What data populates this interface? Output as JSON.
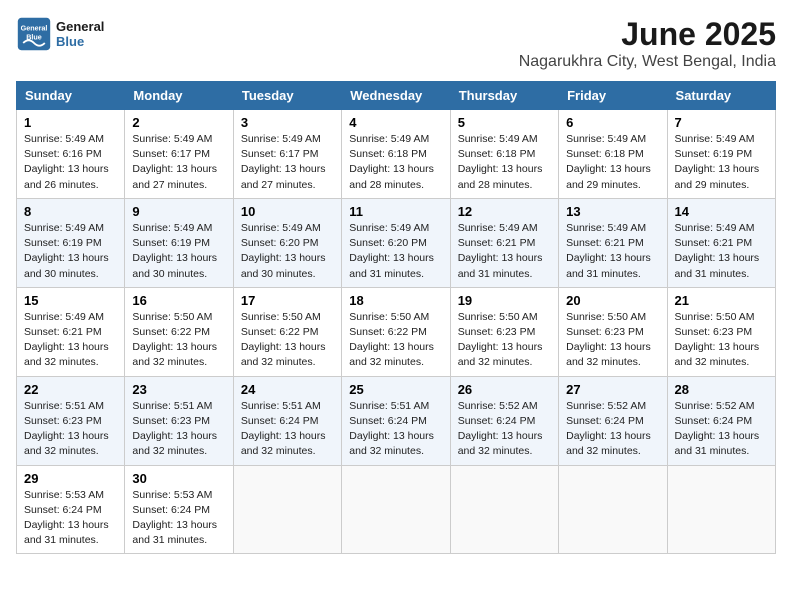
{
  "logo": {
    "line1": "General",
    "line2": "Blue"
  },
  "title": "June 2025",
  "subtitle": "Nagarukhra City, West Bengal, India",
  "days_of_week": [
    "Sunday",
    "Monday",
    "Tuesday",
    "Wednesday",
    "Thursday",
    "Friday",
    "Saturday"
  ],
  "weeks": [
    [
      {
        "day": "1",
        "sunrise": "5:49 AM",
        "sunset": "6:16 PM",
        "daylight": "13 hours and 26 minutes."
      },
      {
        "day": "2",
        "sunrise": "5:49 AM",
        "sunset": "6:17 PM",
        "daylight": "13 hours and 27 minutes."
      },
      {
        "day": "3",
        "sunrise": "5:49 AM",
        "sunset": "6:17 PM",
        "daylight": "13 hours and 27 minutes."
      },
      {
        "day": "4",
        "sunrise": "5:49 AM",
        "sunset": "6:18 PM",
        "daylight": "13 hours and 28 minutes."
      },
      {
        "day": "5",
        "sunrise": "5:49 AM",
        "sunset": "6:18 PM",
        "daylight": "13 hours and 28 minutes."
      },
      {
        "day": "6",
        "sunrise": "5:49 AM",
        "sunset": "6:18 PM",
        "daylight": "13 hours and 29 minutes."
      },
      {
        "day": "7",
        "sunrise": "5:49 AM",
        "sunset": "6:19 PM",
        "daylight": "13 hours and 29 minutes."
      }
    ],
    [
      {
        "day": "8",
        "sunrise": "5:49 AM",
        "sunset": "6:19 PM",
        "daylight": "13 hours and 30 minutes."
      },
      {
        "day": "9",
        "sunrise": "5:49 AM",
        "sunset": "6:19 PM",
        "daylight": "13 hours and 30 minutes."
      },
      {
        "day": "10",
        "sunrise": "5:49 AM",
        "sunset": "6:20 PM",
        "daylight": "13 hours and 30 minutes."
      },
      {
        "day": "11",
        "sunrise": "5:49 AM",
        "sunset": "6:20 PM",
        "daylight": "13 hours and 31 minutes."
      },
      {
        "day": "12",
        "sunrise": "5:49 AM",
        "sunset": "6:21 PM",
        "daylight": "13 hours and 31 minutes."
      },
      {
        "day": "13",
        "sunrise": "5:49 AM",
        "sunset": "6:21 PM",
        "daylight": "13 hours and 31 minutes."
      },
      {
        "day": "14",
        "sunrise": "5:49 AM",
        "sunset": "6:21 PM",
        "daylight": "13 hours and 31 minutes."
      }
    ],
    [
      {
        "day": "15",
        "sunrise": "5:49 AM",
        "sunset": "6:21 PM",
        "daylight": "13 hours and 32 minutes."
      },
      {
        "day": "16",
        "sunrise": "5:50 AM",
        "sunset": "6:22 PM",
        "daylight": "13 hours and 32 minutes."
      },
      {
        "day": "17",
        "sunrise": "5:50 AM",
        "sunset": "6:22 PM",
        "daylight": "13 hours and 32 minutes."
      },
      {
        "day": "18",
        "sunrise": "5:50 AM",
        "sunset": "6:22 PM",
        "daylight": "13 hours and 32 minutes."
      },
      {
        "day": "19",
        "sunrise": "5:50 AM",
        "sunset": "6:23 PM",
        "daylight": "13 hours and 32 minutes."
      },
      {
        "day": "20",
        "sunrise": "5:50 AM",
        "sunset": "6:23 PM",
        "daylight": "13 hours and 32 minutes."
      },
      {
        "day": "21",
        "sunrise": "5:50 AM",
        "sunset": "6:23 PM",
        "daylight": "13 hours and 32 minutes."
      }
    ],
    [
      {
        "day": "22",
        "sunrise": "5:51 AM",
        "sunset": "6:23 PM",
        "daylight": "13 hours and 32 minutes."
      },
      {
        "day": "23",
        "sunrise": "5:51 AM",
        "sunset": "6:23 PM",
        "daylight": "13 hours and 32 minutes."
      },
      {
        "day": "24",
        "sunrise": "5:51 AM",
        "sunset": "6:24 PM",
        "daylight": "13 hours and 32 minutes."
      },
      {
        "day": "25",
        "sunrise": "5:51 AM",
        "sunset": "6:24 PM",
        "daylight": "13 hours and 32 minutes."
      },
      {
        "day": "26",
        "sunrise": "5:52 AM",
        "sunset": "6:24 PM",
        "daylight": "13 hours and 32 minutes."
      },
      {
        "day": "27",
        "sunrise": "5:52 AM",
        "sunset": "6:24 PM",
        "daylight": "13 hours and 32 minutes."
      },
      {
        "day": "28",
        "sunrise": "5:52 AM",
        "sunset": "6:24 PM",
        "daylight": "13 hours and 31 minutes."
      }
    ],
    [
      {
        "day": "29",
        "sunrise": "5:53 AM",
        "sunset": "6:24 PM",
        "daylight": "13 hours and 31 minutes."
      },
      {
        "day": "30",
        "sunrise": "5:53 AM",
        "sunset": "6:24 PM",
        "daylight": "13 hours and 31 minutes."
      },
      null,
      null,
      null,
      null,
      null
    ]
  ],
  "labels": {
    "sunrise": "Sunrise:",
    "sunset": "Sunset:",
    "daylight": "Daylight:"
  }
}
